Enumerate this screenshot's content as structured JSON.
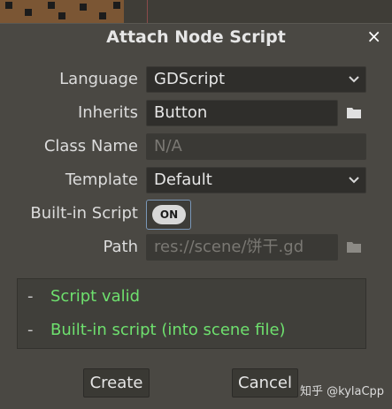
{
  "dialog": {
    "title": "Attach Node Script",
    "close_glyph": "×"
  },
  "form": {
    "language": {
      "label": "Language",
      "value": "GDScript"
    },
    "inherits": {
      "label": "Inherits",
      "value": "Button"
    },
    "class_name": {
      "label": "Class Name",
      "placeholder": "N/A"
    },
    "template": {
      "label": "Template",
      "value": "Default"
    },
    "builtin": {
      "label": "Built-in Script",
      "toggle_text": "ON"
    },
    "path": {
      "label": "Path",
      "value": "res://scene/饼干.gd"
    }
  },
  "status": {
    "items": [
      {
        "dash": "-",
        "text": "Script valid"
      },
      {
        "dash": "-",
        "text": "Built-in script (into scene file)"
      }
    ],
    "text_color": "#6ee06e"
  },
  "buttons": {
    "create": "Create",
    "cancel": "Cancel"
  },
  "watermark": "知乎 @kylaCpp",
  "icons": {
    "close": "close-icon",
    "dropdown": "chevron-down-icon",
    "folder": "folder-icon"
  }
}
